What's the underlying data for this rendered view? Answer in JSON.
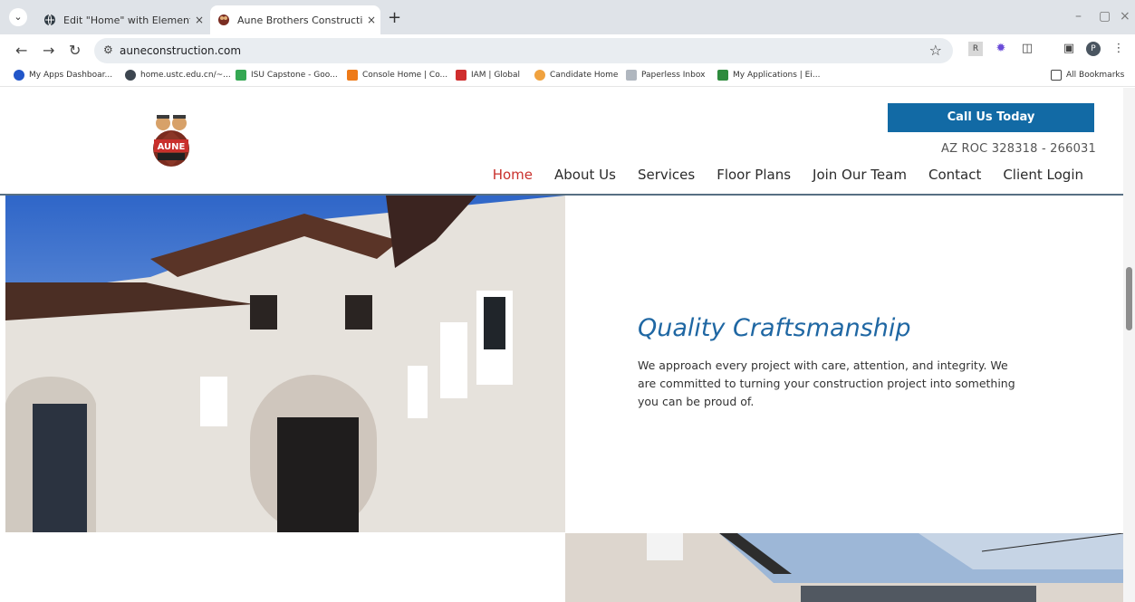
{
  "browser": {
    "tabs": [
      {
        "label": "Edit \"Home\" with Elementor",
        "close": "×"
      },
      {
        "label": "Aune Brothers Construction",
        "close": "×"
      }
    ],
    "new_tab": "+",
    "url": "auneconstruction.com",
    "bookmarks": [
      "My Apps Dashboar...",
      "home.ustc.edu.cn/~...",
      "ISU Capstone - Goo...",
      "Console Home | Co...",
      "IAM | Global",
      "Candidate Home",
      "Paperless Inbox",
      "My Applications | Ei..."
    ],
    "all_bookmarks": "All Bookmarks",
    "profile_initial": "P",
    "icons": [
      "tab-search-icon",
      "back-icon",
      "forward-icon",
      "reload-icon",
      "site-info-icon",
      "star-icon",
      "extension-icon",
      "sidepanel-icon",
      "menu-icon"
    ]
  },
  "site": {
    "cta": "Call Us Today",
    "license": "AZ ROC 328318 - 266031",
    "nav": [
      "Home",
      "About Us",
      "Services",
      "Floor Plans",
      "Join Our Team",
      "Contact",
      "Client Login"
    ],
    "active_nav": "Home",
    "hero_title": "Quality Craftsmanship",
    "hero_body": "We approach every project with care, attention, and integrity. We are committed to turning your construction project into something you can be proud of."
  },
  "colors": {
    "primary": "#126aa5",
    "heading": "#1f67a3",
    "active": "#c9302c",
    "header_line": "#1f3f5a"
  }
}
